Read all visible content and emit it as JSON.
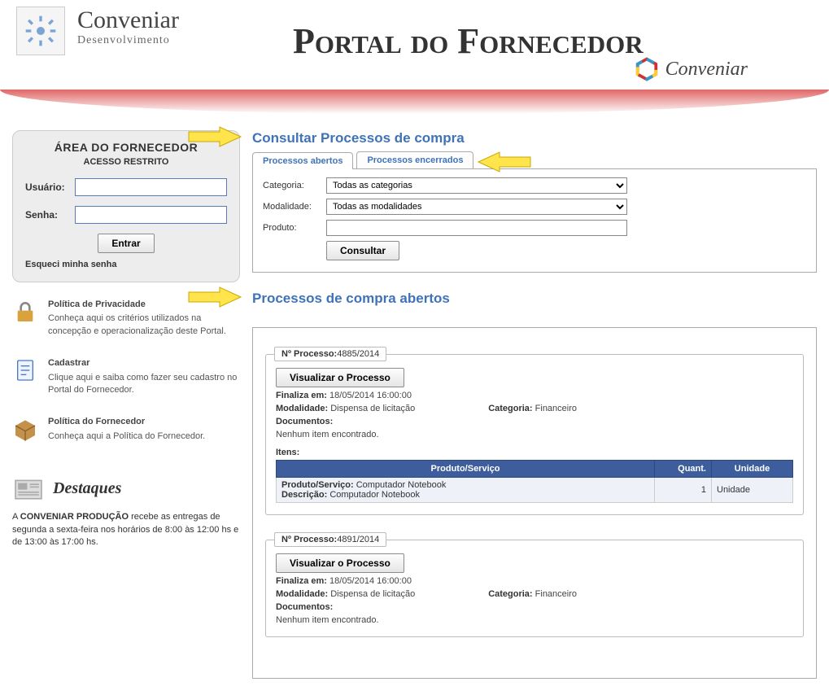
{
  "brand": {
    "name": "Conveniar",
    "sub": "Desenvolvimento"
  },
  "portalTitle": "Portal do Fornecedor",
  "brand2": "Conveniar",
  "login": {
    "title": "ÁREA DO FORNECEDOR",
    "sub": "ACESSO RESTRITO",
    "userLabel": "Usuário:",
    "passLabel": "Senha:",
    "button": "Entrar",
    "forgot": "Esqueci minha senha"
  },
  "sideLinks": {
    "privacy": {
      "title": "Política de Privacidade",
      "desc": "Conheça aqui os critérios utilizados na concepção e operacionalização deste Portal."
    },
    "register": {
      "title": "Cadastrar",
      "desc": "Clique aqui e saiba como fazer seu cadastro no Portal do Fornecedor."
    },
    "policy": {
      "title": "Política do Fornecedor",
      "desc": "Conheça aqui a Política do Fornecedor."
    }
  },
  "destaques": {
    "heading": "Destaques",
    "body_prefix": "A ",
    "body_bold": "CONVENIAR PRODUÇÃO",
    "body_suffix": " recebe as entregas de segunda a sexta-feira nos horários de 8:00 às 12:00 hs e de 13:00 às 17:00 hs."
  },
  "consult": {
    "title": "Consultar Processos de compra",
    "tabOpen": "Processos abertos",
    "tabClosed": "Processos encerrados",
    "categoriaLabel": "Categoria:",
    "categoriaValue": "Todas as categorias",
    "modalidadeLabel": "Modalidade:",
    "modalidadeValue": "Todas as modalidades",
    "produtoLabel": "Produto:",
    "consultarBtn": "Consultar"
  },
  "results": {
    "title": "Processos de compra abertos",
    "procLabel": "Nº Processo:",
    "visualizarBtn": "Visualizar o Processo",
    "finalizaLabel": "Finaliza em:",
    "modalidadeLabel": "Modalidade:",
    "categoriaLabel": "Categoria:",
    "documentosLabel": "Documentos:",
    "nenhum": "Nenhum item encontrado.",
    "itensLabel": "Itens:",
    "colProduto": "Produto/Serviço",
    "colQuant": "Quant.",
    "colUnidade": "Unidade",
    "prodServLabel": "Produto/Serviço:",
    "descLabel": "Descrição:",
    "p1": {
      "numero": "4885/2014",
      "finaliza": "18/05/2014 16:00:00",
      "modalidade": "Dispensa de licitação",
      "categoria": "Financeiro",
      "itemProd": "Computador Notebook",
      "itemDesc": "Computador Notebook",
      "itemQuant": "1",
      "itemUnid": "Unidade"
    },
    "p2": {
      "numero": "4891/2014",
      "finaliza": "18/05/2014 16:00:00",
      "modalidade": "Dispensa de licitação",
      "categoria": "Financeiro"
    }
  }
}
